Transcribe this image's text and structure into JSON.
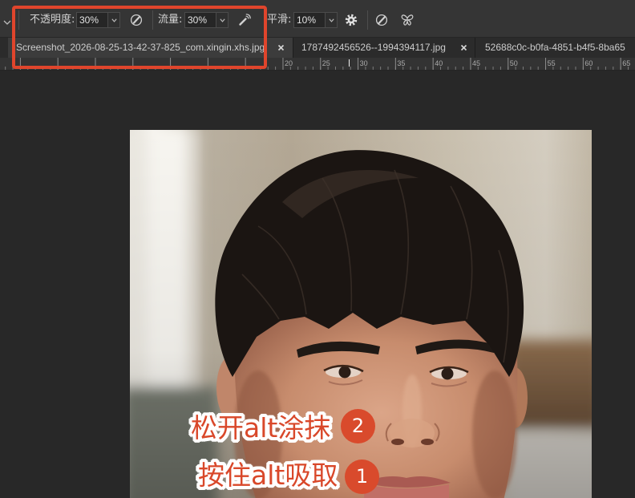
{
  "options_bar": {
    "opacity": {
      "label": "不透明度:",
      "value": "30%"
    },
    "flow": {
      "label": "流量:",
      "value": "30%"
    },
    "smoothing": {
      "label": "平滑:",
      "value": "10%"
    },
    "icons": [
      "chevron-down-icon",
      "pressure-opacity-icon",
      "airbrush-icon",
      "gear-icon",
      "pressure-size-icon",
      "symmetry-butterfly-icon"
    ]
  },
  "tabs": [
    {
      "label": "Screenshot_2026-08-25-13-42-37-825_com.xingin.xhs.jpg",
      "active": true,
      "close_icon": "close-icon"
    },
    {
      "label": "1787492456526--1994394117.jpg",
      "active": false,
      "close_icon": "close-icon"
    },
    {
      "label": "52688c0c-b0fa-4851-b4f5-8ba65",
      "active": false
    }
  ],
  "ruler": {
    "labels": [
      "20",
      "25",
      "30",
      "35",
      "40",
      "45",
      "50",
      "55",
      "60",
      "65"
    ]
  },
  "annotations": [
    {
      "text": "松开alt涂抹",
      "badge": "2"
    },
    {
      "text": "按住alt吸取",
      "badge": "1"
    }
  ],
  "colors": {
    "highlight": "#e0452c",
    "annotation_text": "#d9482a",
    "badge": "#d94a2c",
    "panel": "#353535",
    "canvas": "#282828"
  }
}
